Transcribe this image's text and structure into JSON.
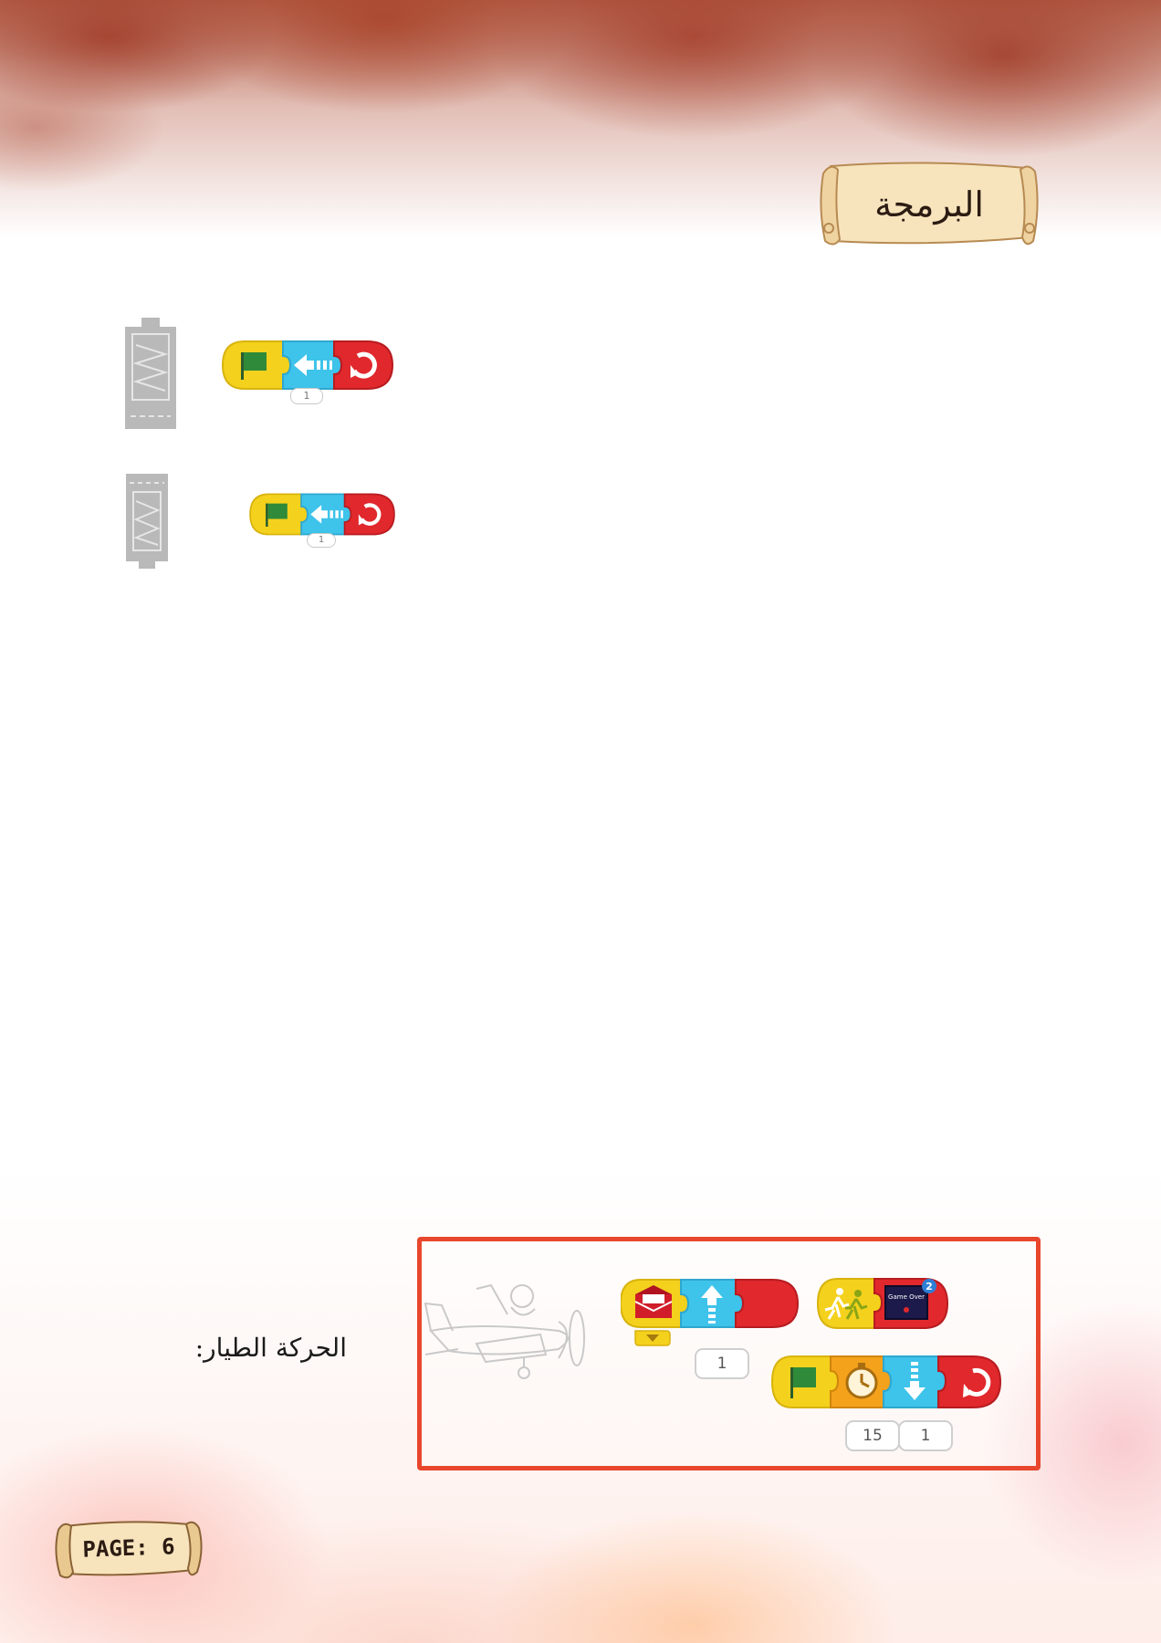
{
  "header": {
    "title": "البرمجة"
  },
  "programs": [
    {
      "badge": "1"
    },
    {
      "badge": "1"
    }
  ],
  "code_box": {
    "motion_label": "الحركة الطيار:",
    "message_count": "1",
    "timer_seconds": "15",
    "move_down_steps": "1",
    "game_over_label": "Game Over",
    "game_over_badge": "2"
  },
  "footer": {
    "page_label": "PAGE: 6"
  },
  "colors": {
    "block_yellow": "#f4d11c",
    "block_blue": "#3ec3ea",
    "block_red": "#e0282d",
    "block_orange": "#f4a21c",
    "flag_green": "#2f8a3a",
    "box_border": "#e8472d",
    "scroll_fill": "#f7e4bd"
  },
  "icons": [
    "green-flag-icon",
    "arrow-left-icon",
    "repeat-icon",
    "arrow-up-icon",
    "arrow-down-icon",
    "envelope-icon",
    "timer-icon",
    "running-people-icon",
    "game-over-icon",
    "airplane-pilot-icon"
  ]
}
